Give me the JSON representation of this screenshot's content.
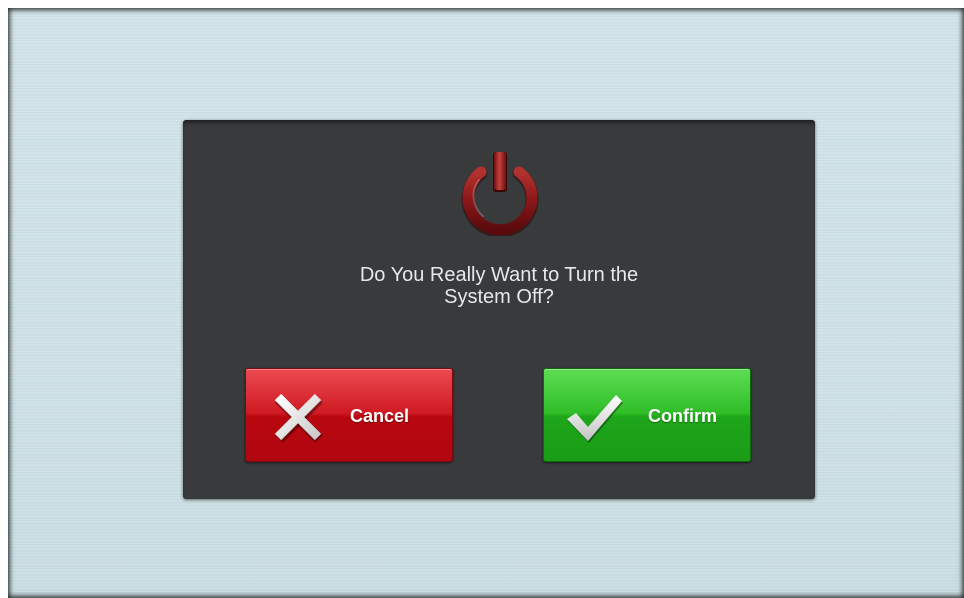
{
  "dialog": {
    "message_line1": "Do You Really Want to Turn the",
    "message_line2": "System Off?",
    "icon": "power-icon"
  },
  "buttons": {
    "cancel_label": "Cancel",
    "cancel_icon": "close-icon",
    "confirm_label": "Confirm",
    "confirm_icon": "checkmark-icon"
  },
  "colors": {
    "background": "#cfe3e8",
    "dialog": "#383a3c",
    "cancel": "#c4101a",
    "confirm": "#2db826",
    "power_icon": "#8c1a1a"
  }
}
